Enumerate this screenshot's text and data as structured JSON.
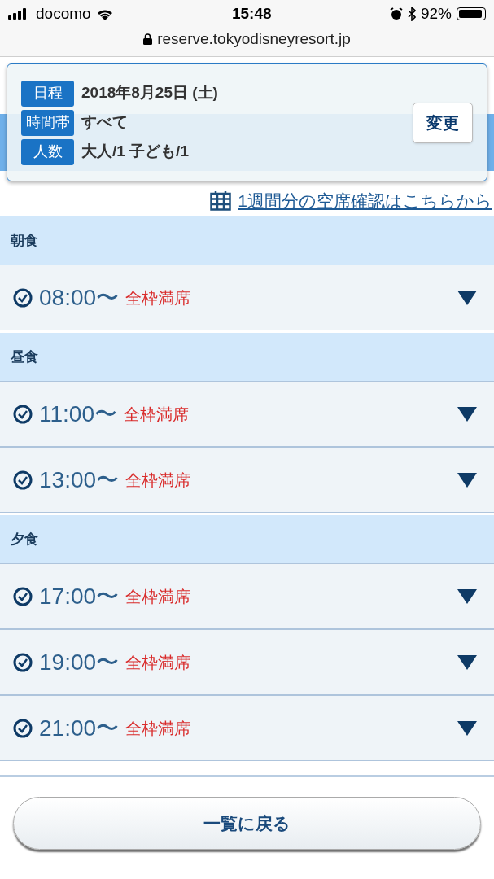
{
  "status_bar": {
    "carrier": "docomo",
    "time": "15:48",
    "battery": "92%"
  },
  "address_bar": {
    "url": "reserve.tokyodisneyresort.jp"
  },
  "search_summary": {
    "rows": [
      {
        "label": "日程",
        "value": "2018年8月25日 (土)"
      },
      {
        "label": "時間帯",
        "value": "すべて"
      },
      {
        "label": "人数",
        "value": "大人/1 子ども/1"
      }
    ],
    "change_button": "変更"
  },
  "week_link": "1週間分の空席確認はこちらから",
  "sections": [
    {
      "title": "朝食",
      "slots": [
        {
          "time": "08:00〜",
          "status": "全枠満席",
          "expanded": false
        }
      ]
    },
    {
      "title": "昼食",
      "slots": [
        {
          "time": "11:00〜",
          "status": "全枠満席",
          "expanded": false
        },
        {
          "time": "13:00〜",
          "status": "全枠満席",
          "expanded": false
        }
      ]
    },
    {
      "title": "夕食",
      "slots": [
        {
          "time": "17:00〜",
          "status": "全枠満席",
          "expanded": false
        },
        {
          "time": "19:00〜",
          "status": "全枠満席",
          "expanded": false
        },
        {
          "time": "21:00〜",
          "status": "全枠満席",
          "expanded": false
        }
      ]
    }
  ],
  "back_button": "一覧に戻る"
}
